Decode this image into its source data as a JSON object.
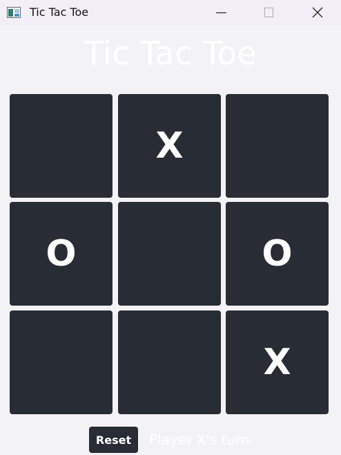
{
  "window": {
    "title": "Tic Tac Toe",
    "icon": "app-window-icon",
    "controls": {
      "minimize": "minimize-icon",
      "maximize": "maximize-icon",
      "close": "close-icon"
    }
  },
  "game": {
    "heading": "Tic Tac Toe",
    "board": [
      "",
      "X",
      "",
      "O",
      "",
      "O",
      "",
      "",
      "X"
    ],
    "reset_label": "Reset",
    "status": "Player X's turn"
  },
  "colors": {
    "cell": "#282c34",
    "mark": "#ffffff",
    "background": "#f3f3f6"
  }
}
